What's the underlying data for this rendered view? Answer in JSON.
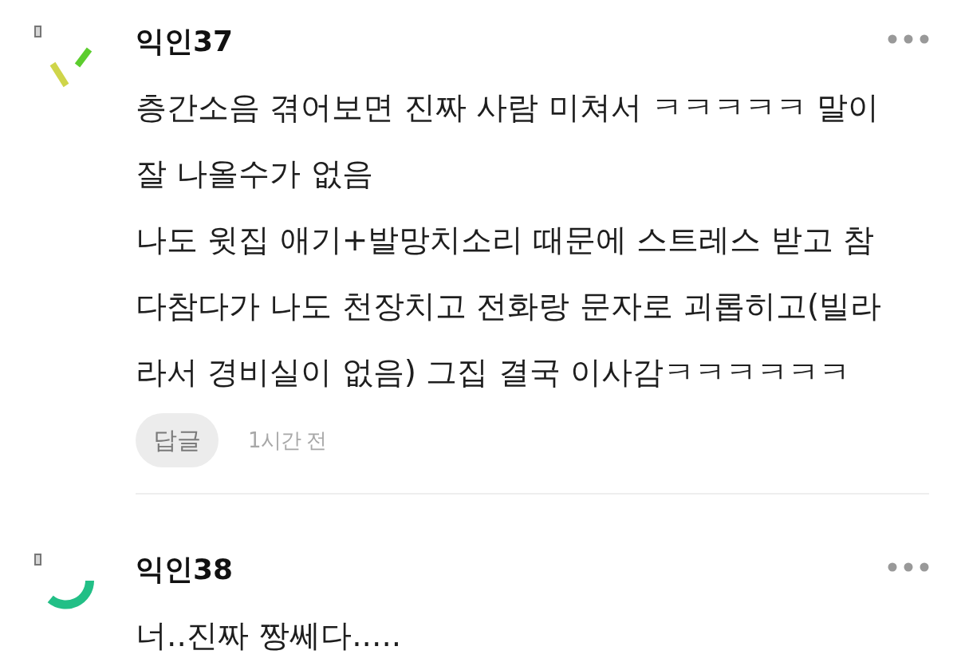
{
  "comments": [
    {
      "author": "익인37",
      "avatar": {
        "kind": "dashes"
      },
      "lines": [
        "층간소음 겪어보면 진짜 사람 미쳐서 ㅋㅋㅋㅋㅋ 말이",
        "잘 나올수가 없음",
        "나도 윗집 애기+발망치소리 때문에 스트레스 받고 참",
        "다참다가 나도 천장치고 전화랑 문자로 괴롭히고(빌라",
        "라서 경비실이 없음) 그집 결국 이사감ㅋㅋㅋㅋㅋㅋ"
      ],
      "reply_button": "답글",
      "time": "1시간 전"
    },
    {
      "author": "익인38",
      "avatar": {
        "kind": "arc"
      },
      "lines": [
        "너..진짜 짱쎄다....."
      ]
    }
  ]
}
